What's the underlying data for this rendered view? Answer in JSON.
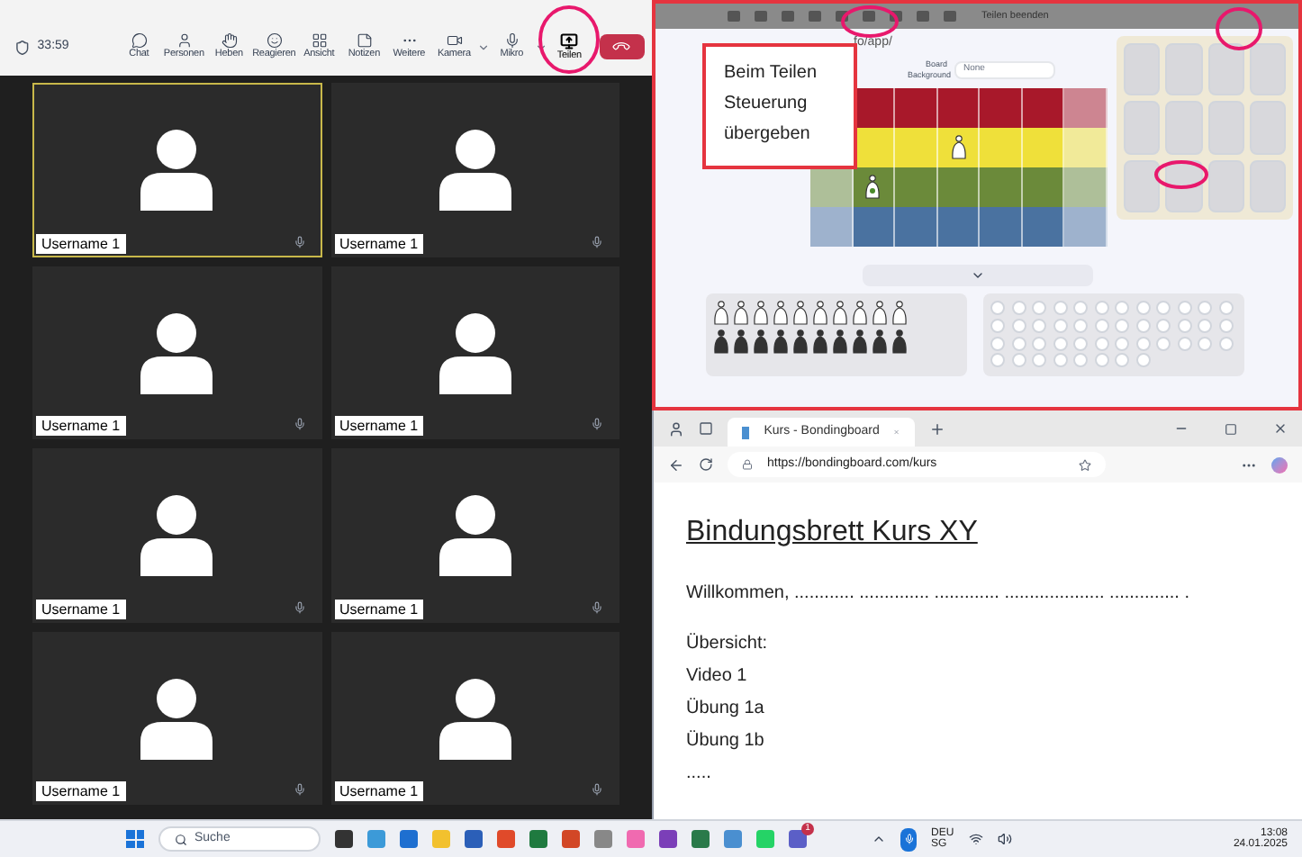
{
  "meeting": {
    "timer": "33:59",
    "toolbar": [
      {
        "kind": "chat",
        "label": "Chat"
      },
      {
        "kind": "people",
        "label": "Personen"
      },
      {
        "kind": "raise",
        "label": "Heben"
      },
      {
        "kind": "react",
        "label": "Reagieren"
      },
      {
        "kind": "view",
        "label": "Ansicht"
      },
      {
        "kind": "notes",
        "label": "Notizen"
      },
      {
        "kind": "more",
        "label": "Weitere"
      },
      {
        "kind": "camera",
        "label": "Kamera"
      },
      {
        "kind": "mic",
        "label": "Mikro"
      },
      {
        "kind": "share",
        "label": "Teilen"
      }
    ]
  },
  "participants": [
    {
      "name": "Username 1",
      "speaking": true
    },
    {
      "name": "Username 1",
      "speaking": false
    },
    {
      "name": "Username 1",
      "speaking": false
    },
    {
      "name": "Username 1",
      "speaking": false
    },
    {
      "name": "Username 1",
      "speaking": false
    },
    {
      "name": "Username 1",
      "speaking": false
    },
    {
      "name": "Username 1",
      "speaking": false
    },
    {
      "name": "Username 1",
      "speaking": false
    }
  ],
  "shared_screen": {
    "callout": "Beim Teilen Steuerung übergeben",
    "address": "fo/app/",
    "board_background_label": "Board Background",
    "board_background_value": "None",
    "stop_sharing": "Teilen beenden"
  },
  "browser": {
    "tab": "Kurs - Bondingboard",
    "url": "https://bondingboard.com/kurs",
    "heading": "Bindungsbrett Kurs XY",
    "welcome": "Willkommen, ............ .............. ............. ....................  .............. .",
    "overview": [
      "Übersicht:",
      "Video 1",
      "Übung 1a",
      "Übung 1b",
      "....."
    ]
  },
  "taskbar": {
    "search": "Suche",
    "notification_badge": "1",
    "language": "DEU",
    "layout": "SG",
    "time": "13:08",
    "date": "24.01.2025"
  }
}
